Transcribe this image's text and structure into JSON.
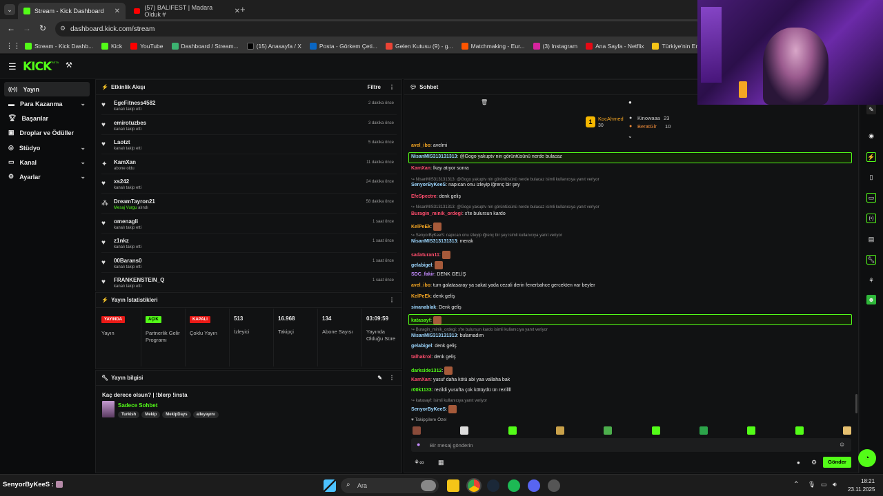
{
  "browser": {
    "tabs": [
      {
        "title": "Stream - Kick Dashboard",
        "active": true
      },
      {
        "title": "(57) BALIFEST | Madara Olduk #",
        "active": false
      }
    ],
    "url": "dashboard.kick.com/stream",
    "bookmarks": [
      "Stream - Kick Dashb...",
      "Kick",
      "YouTube",
      "Dashboard / Stream...",
      "(15) Anasayfa / X",
      "Posta - Görkem Çeti...",
      "Gelen Kutusu (9) - g...",
      "Matchmaking - Eur...",
      "(3) Instagram",
      "Ana Sayfa - Netflix",
      "Türkiye'nin En Büyü..."
    ]
  },
  "app": {
    "logo": "KICK",
    "logo_badge": "BETA",
    "accent": "#53fc18"
  },
  "sidebar": {
    "items": [
      {
        "label": "Yayın",
        "icon": "broadcast-icon",
        "active": true,
        "expandable": false
      },
      {
        "label": "Para Kazanma",
        "icon": "money-icon",
        "expandable": true
      },
      {
        "label": "Başarılar",
        "icon": "trophy-icon",
        "expandable": false
      },
      {
        "label": "Droplar ve Ödüller",
        "icon": "gift-icon",
        "expandable": false
      },
      {
        "label": "Stüdyo",
        "icon": "studio-icon",
        "expandable": true
      },
      {
        "label": "Kanal",
        "icon": "channel-icon",
        "expandable": true
      },
      {
        "label": "Ayarlar",
        "icon": "gear-icon",
        "expandable": true
      }
    ]
  },
  "activity": {
    "title": "Etkinlik Akışı",
    "filter_label": "Filtre",
    "rows": [
      {
        "name": "EgeFitness4582",
        "action": "kanalı takip etti",
        "time": "2 dakika önce",
        "icon": "heart-icon"
      },
      {
        "name": "emirotuzbes",
        "action": "kanalı takip etti",
        "time": "3 dakika önce",
        "icon": "heart-icon"
      },
      {
        "name": "Laotzt",
        "action": "kanalı takip etti",
        "time": "5 dakika önce",
        "icon": "heart-icon"
      },
      {
        "name": "KamXan",
        "action": "abone oldu",
        "time": "11 dakika önce",
        "icon": "star-icon"
      },
      {
        "name": "xs242",
        "action": "kanalı takip etti",
        "time": "24 dakika önce",
        "icon": "heart-icon"
      },
      {
        "name": "DreamTayron21",
        "action_highlight": "Mesaj Vurgu",
        "action": " alındı",
        "time": "58 dakika önce",
        "icon": "sparkle-icon"
      },
      {
        "name": "omenagli",
        "action": "kanalı takip etti",
        "time": "1 saat önce",
        "icon": "heart-icon"
      },
      {
        "name": "z1nkz",
        "action": "kanalı takip etti",
        "time": "1 saat önce",
        "icon": "heart-icon"
      },
      {
        "name": "00Barans0",
        "action": "kanalı takip etti",
        "time": "1 saat önce",
        "icon": "heart-icon"
      },
      {
        "name": "FRANKENSTEIN_Q",
        "action": "kanalı takip etti",
        "time": "1 saat önce",
        "icon": "heart-icon"
      }
    ]
  },
  "stats": {
    "title": "Yayın İstatistikleri",
    "items": [
      {
        "badge": "YAYINDA",
        "badge_color": "#e91916",
        "label": "Yayın"
      },
      {
        "badge": "AÇIK",
        "badge_color": "#53fc18",
        "label": "Partnerlik Gelir Programı"
      },
      {
        "badge": "KAPALI",
        "badge_color": "#e91916",
        "label": "Çoklu Yayın"
      },
      {
        "value": "513",
        "label": "İzleyici"
      },
      {
        "value": "16.968",
        "label": "Takipçi"
      },
      {
        "value": "134",
        "label": "Abone Sayısı"
      },
      {
        "value": "03:09:59",
        "label": "Yayında Olduğu Süre"
      }
    ]
  },
  "stream_info": {
    "title": "Yayın bilgisi",
    "stream_title": "Kaç derece olsun? | !blerp !insta",
    "category": "Sadece Sohbet",
    "tags": [
      "Turkish",
      "Mekip",
      "MekipDays",
      "aileyayını"
    ]
  },
  "chat": {
    "title": "Sohbet",
    "leaderboard": [
      {
        "name": "KocAhmed",
        "count": "30"
      },
      {
        "name": "Kinowaaa",
        "count": "23"
      },
      {
        "name": "BeratGlr",
        "count": "10"
      }
    ],
    "messages": [
      {
        "user": "avel_ibo",
        "color": "#f5a623",
        "text": "avelmi"
      },
      {
        "user": "NisanMIS313131313",
        "color": "#9dd7ff",
        "text": "@Gogo yakuptv nin görüntüsünü nerde bulacaz",
        "highlight": true
      },
      {
        "user": "KamXan",
        "color": "#ff4d6d",
        "text": "İkay atıyor sonra"
      },
      {
        "reply": "NisanMIS313131313: @Gogo yakuptv nin görüntüsünü nerde bulacaz isimli kullanıcıya yanıt veriyor"
      },
      {
        "user": "SenyorByKeeS",
        "color": "#9dd7ff",
        "text": "napıcan onu izleyip iğrenç bir şey"
      },
      {
        "user": "EfeSpectre",
        "color": "#ff4d6d",
        "text": "denk geliş"
      },
      {
        "reply": "NisanMIS313131313: @Gogo yakuptv nin görüntüsünü nerde bulacaz isimli kullanıcıya yanıt veriyor"
      },
      {
        "user": "Buragin_minik_ordegi",
        "color": "#ff4d6d",
        "text": "x'te bulursun kardo"
      },
      {
        "user": "KelPeEk",
        "color": "#f5a623",
        "text": ""
      },
      {
        "reply": "SenyorByKeeS: napıcan onu izleyip iğrenç bir şey isimli kullanıcıya yanıt veriyor"
      },
      {
        "user": "NisanMIS313131313",
        "color": "#9dd7ff",
        "text": "merak"
      },
      {
        "user": "sadaturan11",
        "color": "#ff4d6d",
        "text": ""
      },
      {
        "user": "gelabigel",
        "color": "#9dd7ff",
        "text": ""
      },
      {
        "user": "SDC_fakir",
        "color": "#c58cff",
        "text": "DENK GELİŞ"
      },
      {
        "user": "avel_ibo",
        "color": "#f5a623",
        "text": "tum galatasaray ya sakat yada cezali derin fenerbahce gercekten var beyler"
      },
      {
        "user": "KelPeEk",
        "color": "#f5a623",
        "text": "denk geliş"
      },
      {
        "user": "sinanablak",
        "color": "#9dd7ff",
        "text": "Denk geliş"
      },
      {
        "user": "katasayf",
        "color": "#53fc18",
        "text": "",
        "highlight": true
      },
      {
        "reply": "Buragin_minik_ordegi: x'te bulursun kardo isimli kullanıcıya yanıt veriyor"
      },
      {
        "user": "NisanMIS313131313",
        "color": "#9dd7ff",
        "text": "bulamadım"
      },
      {
        "user": "gelabigel",
        "color": "#9dd7ff",
        "text": "denk geliş"
      },
      {
        "user": "talhakrol",
        "color": "#ff4d6d",
        "text": "denk geliş"
      },
      {
        "user": "darkside1312",
        "color": "#53fc18",
        "text": ""
      },
      {
        "user": "KamXan",
        "color": "#ff4d6d",
        "text": "yusuf daha kötü abi yaa vallaha bak"
      },
      {
        "user": "r00k1133",
        "color": "#53fc18",
        "text": "rezildi yusufta çok kötüydü ün rezillll"
      },
      {
        "reply": "katasayf: isimli kullanıcıya yanıt veriyor"
      },
      {
        "user": "SenyorByKeeS",
        "color": "#9dd7ff",
        "text": ""
      }
    ],
    "followers_only_label": "Takipçilere Özel",
    "input_placeholder": "Bir mesaj gönderin",
    "send_label": "Gönder"
  },
  "taskbar": {
    "search_label": "Ara",
    "time": "18:21",
    "date": "23.11.2025",
    "overlay_user": "SenyorByKeeS :"
  }
}
